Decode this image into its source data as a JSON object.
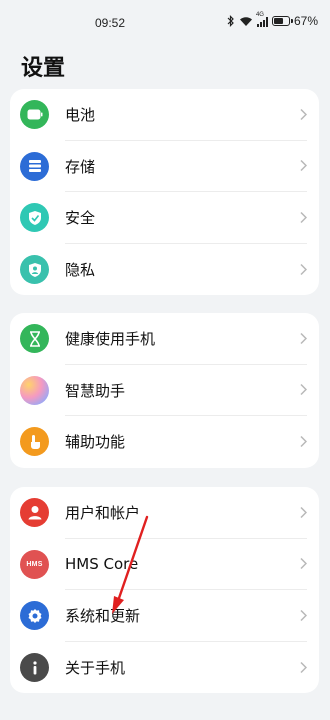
{
  "status_bar": {
    "time": "09:52",
    "network": "4G",
    "battery_percent_label": "67%",
    "battery_level": 0.67
  },
  "page": {
    "title": "设置"
  },
  "groups": [
    {
      "items": [
        {
          "label": "电池",
          "icon": "battery-icon",
          "color": "#33b65a"
        },
        {
          "label": "存储",
          "icon": "storage-icon",
          "color": "#2c6cd6"
        },
        {
          "label": "安全",
          "icon": "security-shield-icon",
          "color": "#2fc8b4"
        },
        {
          "label": "隐私",
          "icon": "privacy-icon",
          "color": "#39c1ad"
        }
      ]
    },
    {
      "items": [
        {
          "label": "健康使用手机",
          "icon": "hourglass-icon",
          "color": "#33b65a"
        },
        {
          "label": "智慧助手",
          "icon": "smart-assistant-icon",
          "color": "#c8a6f0"
        },
        {
          "label": "辅助功能",
          "icon": "hand-accessibility-icon",
          "color": "#f39a1e"
        }
      ]
    },
    {
      "items": [
        {
          "label": "用户和帐户",
          "icon": "user-icon",
          "color": "#e53d33"
        },
        {
          "label": "HMS Core",
          "icon": "hms-core-icon",
          "color": "#e05252"
        },
        {
          "label": "系统和更新",
          "icon": "gear-icon",
          "color": "#2c6cd6"
        },
        {
          "label": "关于手机",
          "icon": "info-icon",
          "color": "#4a4a4a"
        }
      ]
    }
  ],
  "annotation": {
    "arrow_color": "#e02020"
  }
}
